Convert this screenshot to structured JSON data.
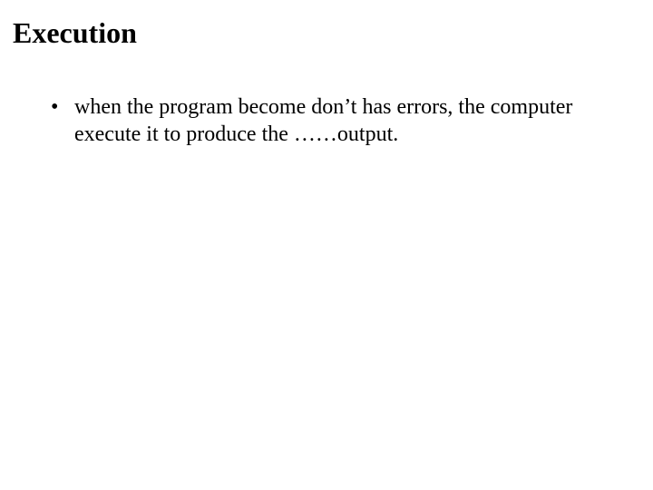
{
  "slide": {
    "title": "Execution",
    "bullets": [
      "when the program become don’t has errors, the computer execute it to produce the ……output."
    ]
  }
}
